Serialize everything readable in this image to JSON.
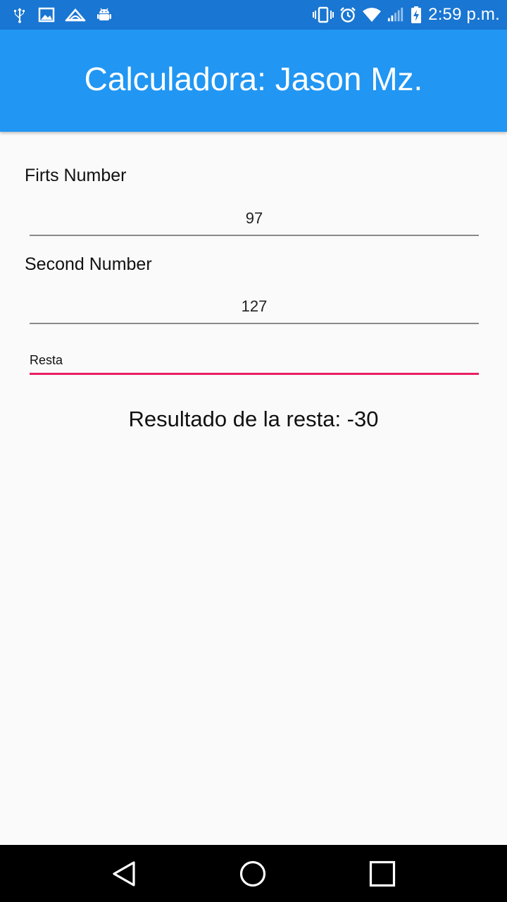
{
  "status_bar": {
    "time": "2:59 p.m.",
    "left_icons": [
      "usb-icon",
      "image-icon",
      "cloud-icon",
      "android-icon"
    ],
    "right_icons": [
      "vibrate-icon",
      "alarm-icon",
      "wifi-icon",
      "signal-icon",
      "battery-charging-icon"
    ]
  },
  "app_bar": {
    "title": "Calculadora: Jason Mz.",
    "color": "#2196f3"
  },
  "form": {
    "first_label": "Firts Number",
    "first_value": "97",
    "second_label": "Second Number",
    "second_value": "127",
    "operation_selected": "Resta",
    "picker_accent": "#e91e63"
  },
  "result": {
    "text": "Resultado de la resta: -30"
  },
  "nav_bar": {
    "buttons": [
      "back-icon",
      "home-icon",
      "recents-icon"
    ]
  }
}
